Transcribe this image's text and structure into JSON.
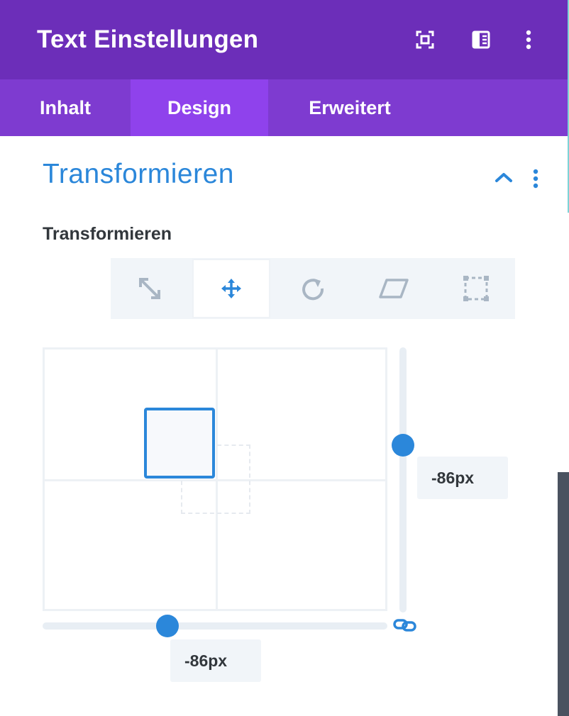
{
  "header": {
    "title": "Text Einstellungen"
  },
  "tabs": [
    {
      "label": "Inhalt",
      "active": false
    },
    {
      "label": "Design",
      "active": true
    },
    {
      "label": "Erweitert",
      "active": false
    }
  ],
  "section": {
    "title": "Transformieren",
    "collapsed": false
  },
  "field": {
    "label": "Transformieren",
    "transform_modes": [
      "scale-icon",
      "translate-icon",
      "rotate-icon",
      "skew-icon",
      "origin-icon"
    ],
    "active_mode": "translate-icon"
  },
  "translate": {
    "x_value": "-86px",
    "y_value": "-86px",
    "linked": true
  },
  "colors": {
    "header_bg": "#6c2eb9",
    "tabs_bg": "#7e3bd0",
    "active_tab_bg": "#8f42ec",
    "accent": "#2b87da"
  }
}
